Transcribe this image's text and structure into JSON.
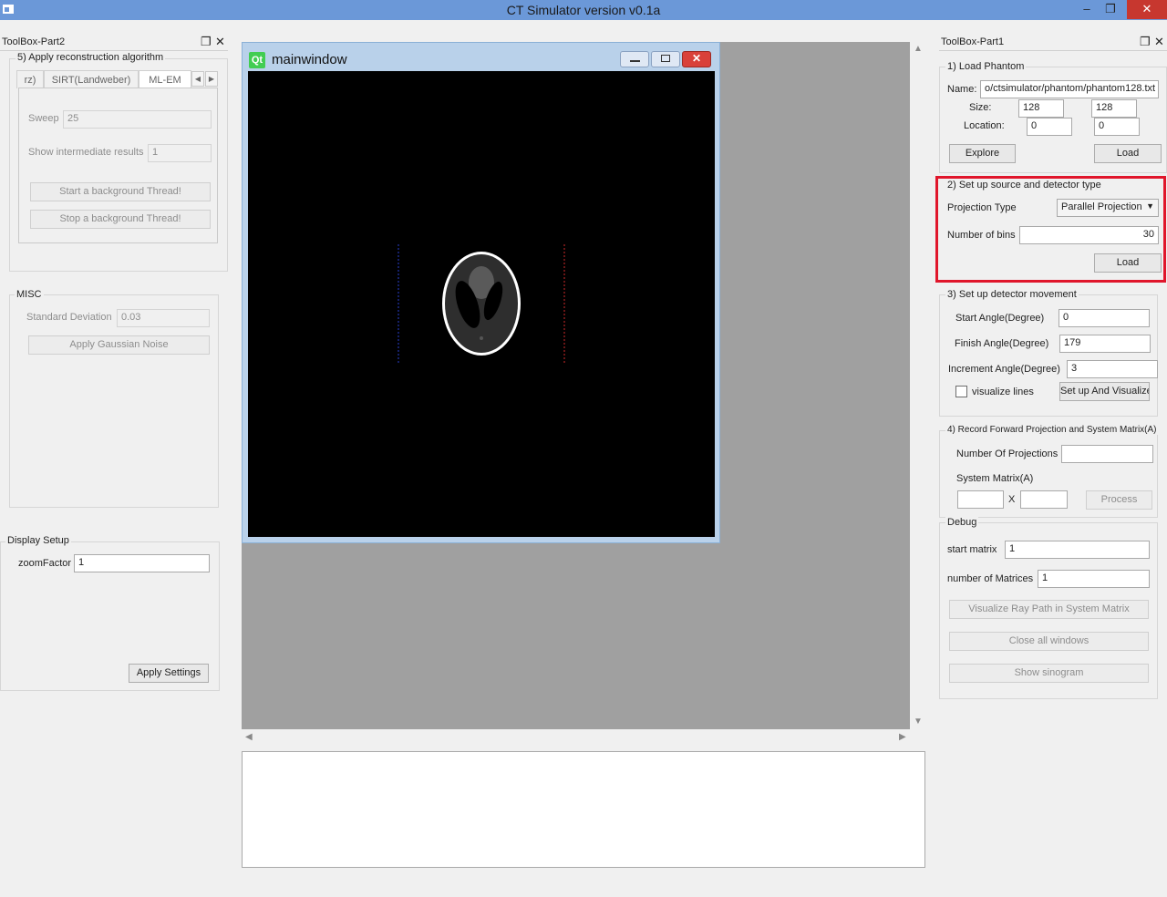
{
  "app": {
    "title": "CT Simulator version v0.1a"
  },
  "window_controls": {
    "minimize": "–",
    "maximize": "❐",
    "close": "✕"
  },
  "toolbox2": {
    "title": "ToolBox-Part2",
    "recon": {
      "label": "5) Apply reconstruction algorithm",
      "tabs": [
        "rz)",
        "SIRT(Landweber)",
        "ML-EM"
      ],
      "sweep_label": "Sweep",
      "sweep_value": "25",
      "intermediate_label": "Show intermediate results",
      "intermediate_value": "1",
      "start_thread": "Start a background Thread!",
      "stop_thread": "Stop a background Thread!"
    },
    "misc": {
      "label": "MISC",
      "std_label": "Standard Deviation",
      "std_value": "0.03",
      "apply_noise": "Apply Gaussian Noise"
    },
    "display": {
      "label": "Display Setup",
      "zoom_label": "zoomFactor",
      "zoom_value": "1",
      "apply_settings": "Apply Settings"
    }
  },
  "mainwindow": {
    "title": "mainwindow",
    "qt_logo": "Qt"
  },
  "toolbox1": {
    "title": "ToolBox-Part1",
    "load_phantom": {
      "label": "1) Load Phantom",
      "name_label": "Name:",
      "name_value": "o/ctsimulator/phantom/phantom128.txt",
      "size_label": "Size:",
      "size_w": "128",
      "size_h": "128",
      "location_label": "Location:",
      "loc_x": "0",
      "loc_y": "0",
      "explore": "Explore",
      "load": "Load"
    },
    "source": {
      "label": "2) Set up source and detector type",
      "proj_type_label": "Projection Type",
      "proj_type_value": "Parallel Projection",
      "bins_label": "Number of bins",
      "bins_value": "30",
      "load": "Load"
    },
    "movement": {
      "label": "3) Set up detector movement",
      "start_label": "Start Angle(Degree)",
      "start_value": "0",
      "finish_label": "Finish Angle(Degree)",
      "finish_value": "179",
      "inc_label": "Increment Angle(Degree)",
      "inc_value": "3",
      "visualize_label": "visualize lines",
      "setup_btn": "Set up And Visualize"
    },
    "record": {
      "label": "4) Record Forward Projection and System Matrix(A)",
      "num_proj_label": "Number Of Projections",
      "num_proj_value": "",
      "sysmat_label": "System Matrix(A)",
      "x_label": "X",
      "process": "Process"
    },
    "debug": {
      "label": "Debug",
      "start_matrix_label": "start matrix",
      "start_matrix_value": "1",
      "num_matrices_label": "number of Matrices",
      "num_matrices_value": "1",
      "visualize_ray": "Visualize Ray Path in System Matrix",
      "close_all": "Close all windows",
      "show_sinogram": "Show sinogram"
    }
  },
  "colors": {
    "title_bar": "#6b98d8",
    "highlight": "#e0162b",
    "close_red": "#c7372f"
  }
}
